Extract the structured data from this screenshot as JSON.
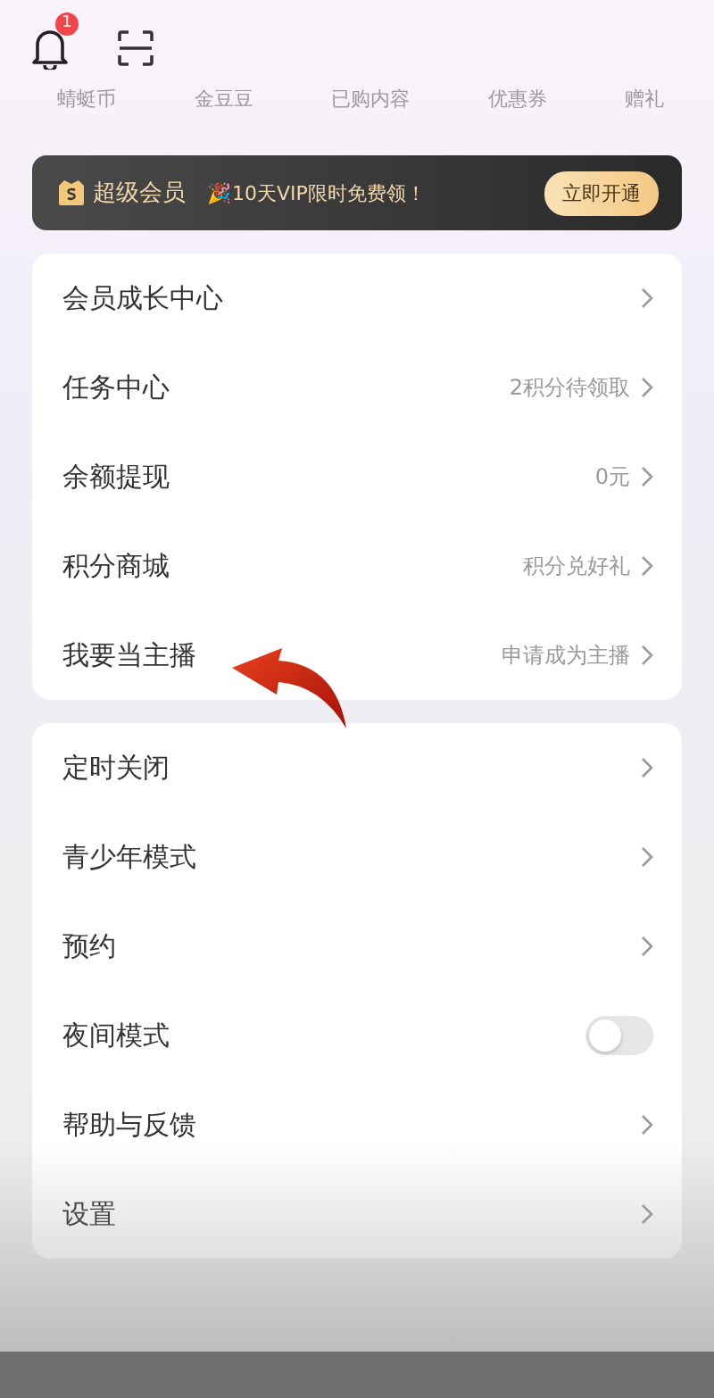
{
  "header": {
    "notification_badge": "1"
  },
  "shortcuts": [
    "蜻蜓币",
    "金豆豆",
    "已购内容",
    "优惠券",
    "赠礼"
  ],
  "vip_banner": {
    "title": "超级会员",
    "promo": "🎉10天VIP限时免费领！",
    "button": "立即开通"
  },
  "menu_groups": [
    {
      "items": [
        {
          "kind": "link",
          "label": "会员成长中心"
        },
        {
          "kind": "link",
          "label": "任务中心",
          "value": "2积分待领取"
        },
        {
          "kind": "link",
          "label": "余额提现",
          "value": "0元"
        },
        {
          "kind": "link",
          "label": "积分商城",
          "value": "积分兑好礼"
        },
        {
          "kind": "link",
          "label": "我要当主播",
          "value": "申请成为主播"
        }
      ]
    },
    {
      "items": [
        {
          "kind": "link",
          "label": "定时关闭"
        },
        {
          "kind": "link",
          "label": "青少年模式"
        },
        {
          "kind": "link",
          "label": "预约"
        },
        {
          "kind": "toggle",
          "label": "夜间模式",
          "on": false
        },
        {
          "kind": "link",
          "label": "帮助与反馈"
        },
        {
          "kind": "link",
          "label": "设置"
        }
      ]
    }
  ]
}
